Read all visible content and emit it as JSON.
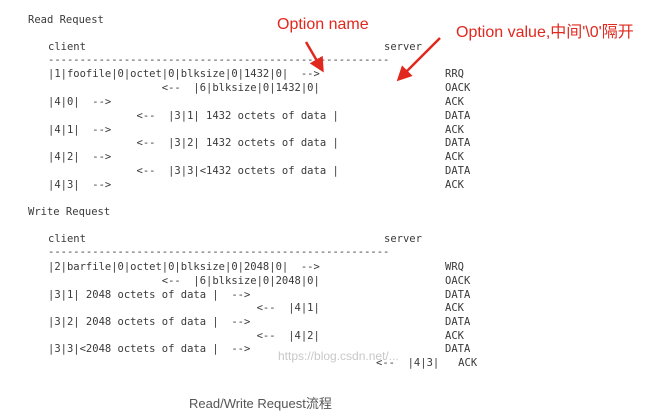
{
  "read_request": {
    "heading": "Read Request",
    "client_label": "client",
    "server_label": "server",
    "divider": "------------------------------------------------------",
    "lines": [
      {
        "left": "|1|foofile|0|octet|0|blksize|0|1432|0|  -->",
        "right": "RRQ"
      },
      {
        "left": "                  <--  |6|blksize|0|1432|0|",
        "right": "OACK"
      },
      {
        "left": "|4|0|  -->",
        "right": "ACK"
      },
      {
        "left": "              <--  |3|1| 1432 octets of data |",
        "right": "DATA"
      },
      {
        "left": "|4|1|  -->",
        "right": "ACK"
      },
      {
        "left": "              <--  |3|2| 1432 octets of data |",
        "right": "DATA"
      },
      {
        "left": "|4|2|  -->",
        "right": "ACK"
      },
      {
        "left": "              <--  |3|3|<1432 octets of data |",
        "right": "DATA"
      },
      {
        "left": "|4|3|  -->",
        "right": "ACK"
      }
    ]
  },
  "write_request": {
    "heading": "Write Request",
    "client_label": "client",
    "server_label": "server",
    "divider": "------------------------------------------------------",
    "lines": [
      {
        "left": "|2|barfile|0|octet|0|blksize|0|2048|0|  -->",
        "right": "WRQ"
      },
      {
        "left": "                  <--  |6|blksize|0|2048|0|",
        "right": "OACK"
      },
      {
        "left": "|3|1| 2048 octets of data |  -->",
        "right": "DATA"
      },
      {
        "left": "                                 <--  |4|1|",
        "right": "ACK"
      },
      {
        "left": "|3|2| 2048 octets of data |  -->",
        "right": "DATA"
      },
      {
        "left": "                                 <--  |4|2|",
        "right": "ACK"
      },
      {
        "left": "|3|3|<2048 octets of data |  -->",
        "right": "DATA"
      }
    ],
    "last_line": "<--  |4|3|   ACK"
  },
  "annotations": {
    "option_name": "Option name",
    "option_value": "Option value,中间'\\0'隔开"
  },
  "watermark": "https://blog.csdn.net/...",
  "caption": "Read/Write Request流程",
  "colors": {
    "annotation": "#e0281e",
    "text": "#3a3a3a",
    "caption": "#555555"
  }
}
